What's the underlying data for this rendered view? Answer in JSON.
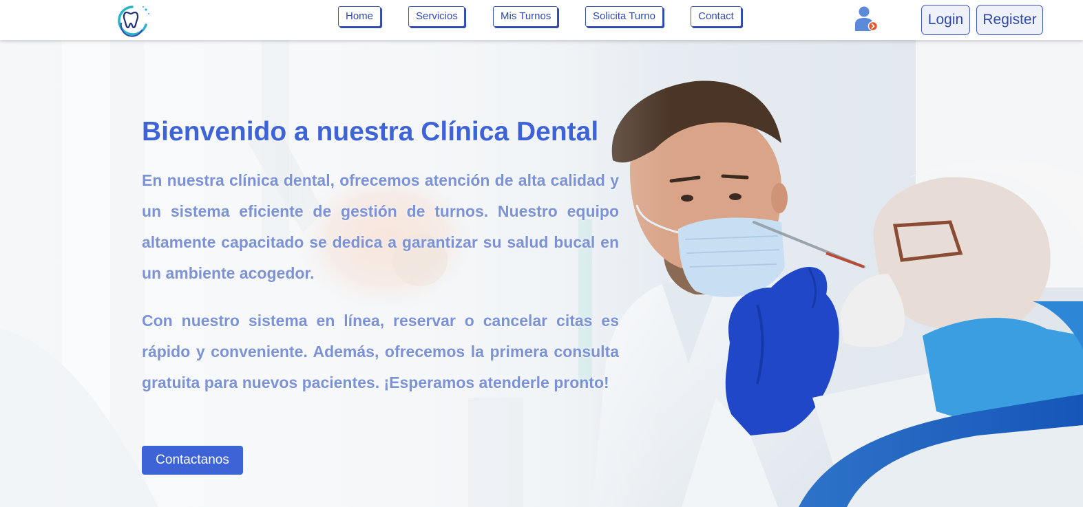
{
  "nav": {
    "links": [
      {
        "label": "Home"
      },
      {
        "label": "Servicios"
      },
      {
        "label": "Mis Turnos"
      },
      {
        "label": "Solicita Turno"
      },
      {
        "label": "Contact"
      }
    ],
    "login_label": "Login",
    "register_label": "Register"
  },
  "hero": {
    "title": "Bienvenido a nuestra Clínica Dental",
    "paragraph_1": "En nuestra clínica dental, ofrecemos atención de alta calidad y un sistema eficiente de gestión de turnos. Nuestro equipo altamente capacitado se dedica a garantizar su salud bucal en un ambiente acogedor.",
    "paragraph_2": "Con nuestro sistema en línea, reservar o cancelar citas es rápido y conveniente. Además, ofrecemos la primera consulta gratuita para nuevos pacientes. ¡Esperamos atenderle pronto!",
    "cta_label": "Contactanos"
  },
  "icons": {
    "logo": "tooth-logo-icon",
    "user": "user-logout-icon"
  },
  "colors": {
    "primary": "#3e63d6",
    "nav_border": "#2f4aa8",
    "paragraph": "#7b92d6",
    "glove": "#1f47c8",
    "badge": "#e2572c"
  }
}
